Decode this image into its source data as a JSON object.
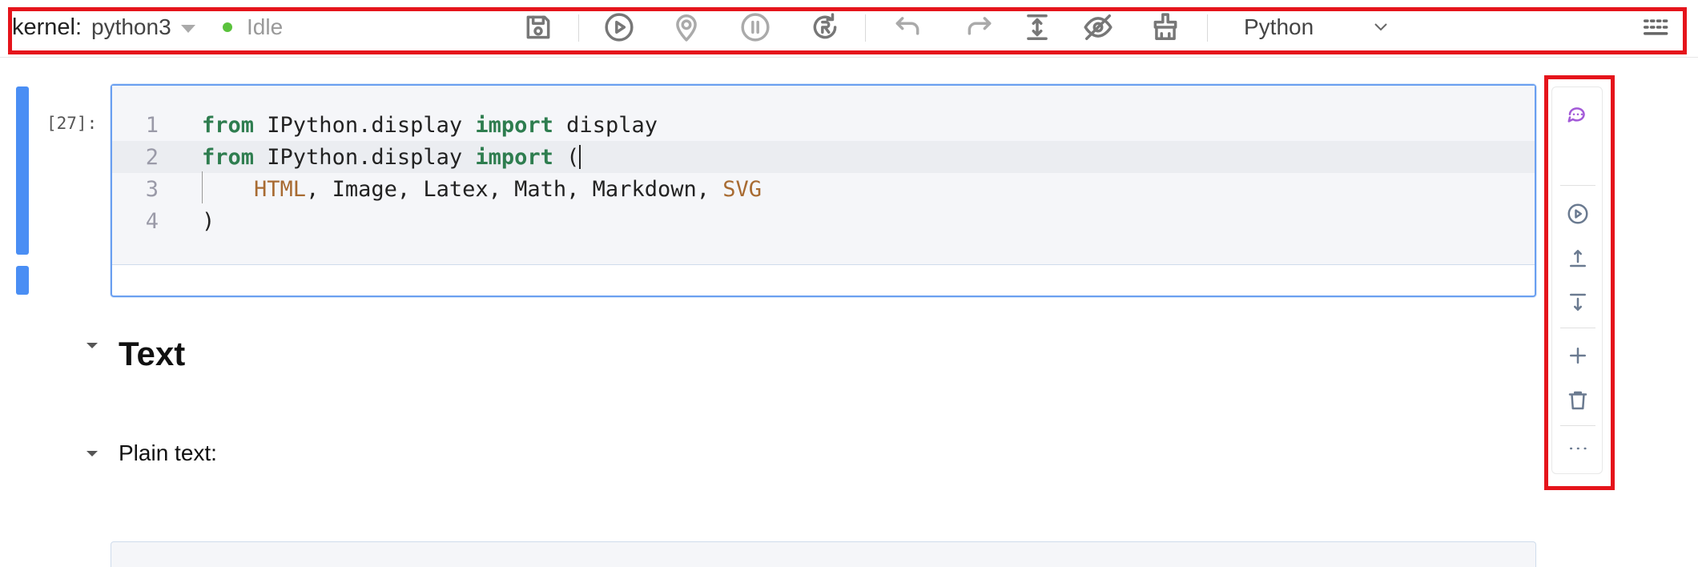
{
  "toolbar": {
    "kernel_label": "kernel:",
    "kernel_name": "python3",
    "status": "Idle",
    "language": "Python",
    "colors": {
      "status_dot": "#5ac23c",
      "ai_accent": "#a35ad8",
      "highlight_frame": "#e5141b"
    },
    "icons": [
      "save-icon",
      "run-icon",
      "location-icon",
      "pause-icon",
      "restart-icon",
      "undo-icon",
      "redo-icon",
      "expand-height-icon",
      "eye-off-icon",
      "clear-icon",
      "chevron-down-icon",
      "ai-sparkle-icon",
      "grid-menu-icon"
    ]
  },
  "cell": {
    "prompt": "[27]:",
    "lines": [
      {
        "number": "1"
      },
      {
        "number": "2"
      },
      {
        "number": "3"
      },
      {
        "number": "4"
      }
    ],
    "code": {
      "l1_kw1": "from",
      "l1_mod": " IPython.display ",
      "l1_kw2": "import",
      "l1_name": " display",
      "l2_kw1": "from",
      "l2_mod": " IPython.display ",
      "l2_kw2": "import",
      "l2_paren": " (",
      "l3_indent": "    ",
      "l3_html": "HTML",
      "l3_mid": ", Image, Latex, Math, Markdown, ",
      "l3_svg": "SVG",
      "l4_paren": ")"
    },
    "active_line": 2
  },
  "cell_toolbar": {
    "icons": [
      "chat-icon",
      "ai-sparkle-icon",
      "run-cell-icon",
      "insert-above-icon",
      "insert-below-icon",
      "add-cell-icon",
      "delete-icon",
      "more-icon"
    ]
  },
  "markdown": {
    "heading": "Text",
    "plain_label": "Plain text:"
  }
}
